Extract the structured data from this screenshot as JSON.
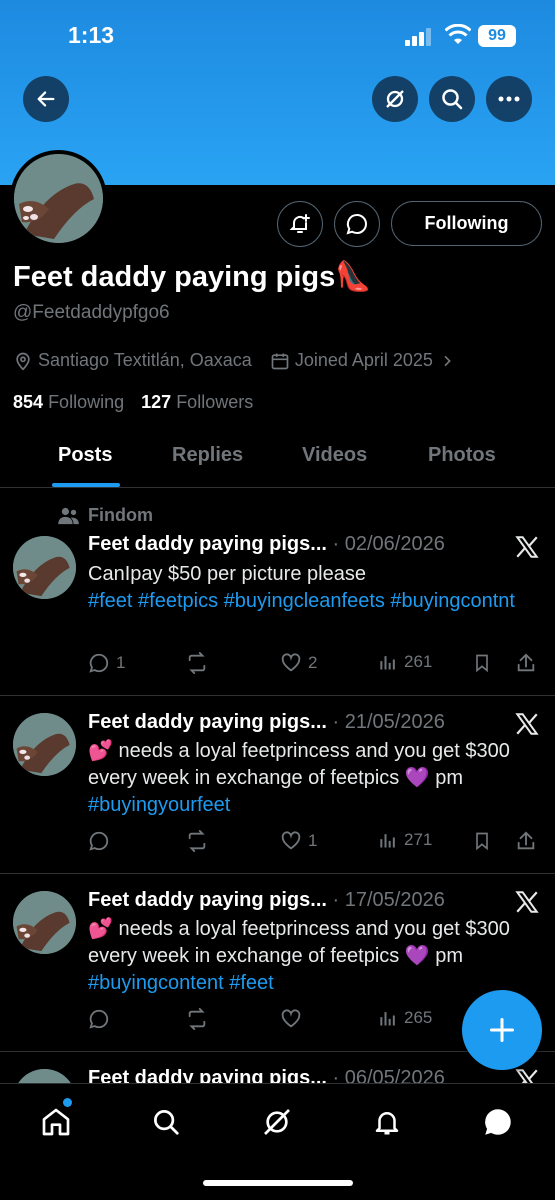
{
  "status_bar": {
    "time": "1:13",
    "battery": "99"
  },
  "profile": {
    "name": "Feet daddy paying pigs👠",
    "handle": "@Feetdaddypfgo6",
    "location": "Santiago Textitlán, Oaxaca",
    "joined": "Joined April 2025",
    "following_count": "854",
    "following_label": "Following",
    "followers_count": "127",
    "followers_label": "Followers",
    "follow_button": "Following"
  },
  "tabs": [
    "Posts",
    "Replies",
    "Videos",
    "Photos"
  ],
  "social_context": "Findom",
  "posts": [
    {
      "name": "Feet daddy paying pigs...",
      "date": "· 02/06/2026",
      "text": "CanIpay $50 per picture please",
      "tags": "#feet #feetpics #buyingcleanfeets #buyingcontnt",
      "replies": "1",
      "likes": "2",
      "views": "261"
    },
    {
      "name": "Feet daddy paying pigs...",
      "date": "· 21/05/2026",
      "text": "💕 needs a loyal feetprincess and you get $300 every week in exchange of feetpics 💜 pm",
      "tags": "#buyingyourfeet",
      "replies": "",
      "likes": "1",
      "views": "271"
    },
    {
      "name": "Feet daddy paying pigs...",
      "date": "· 17/05/2026",
      "text": "💕 needs a loyal feetprincess and you get $300 every week in exchange of feetpics 💜 pm",
      "tags": "#buyingcontent #feet",
      "replies": "",
      "likes": "",
      "views": "265"
    },
    {
      "name": "Feet daddy paying pigs...",
      "date": "· 06/05/2026"
    }
  ],
  "colors": {
    "accent": "#1d9bf0",
    "banner": "#2aa3f3",
    "muted": "#71767b"
  }
}
